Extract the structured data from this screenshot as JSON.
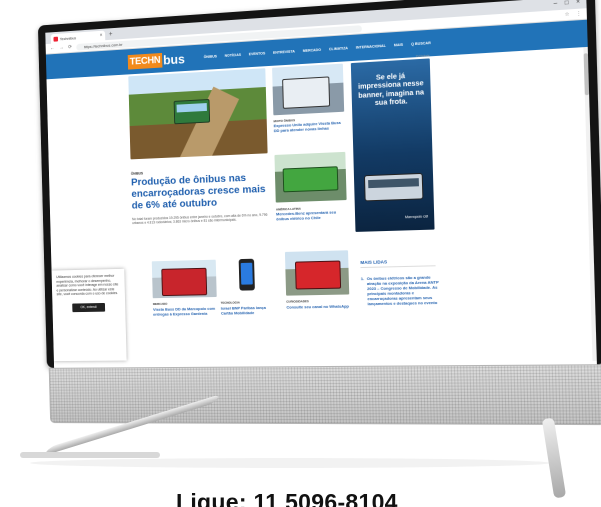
{
  "browser": {
    "tab_title": "Technibus",
    "tab_close": "×",
    "tab_new": "+",
    "url": "https://technibus.com.br",
    "window_controls": [
      "–",
      "□",
      "×"
    ],
    "nav_icons": [
      "←",
      "→",
      "⟳"
    ],
    "toolbar_icons": [
      "☆",
      "⋮"
    ]
  },
  "site": {
    "logo_tech": "TECHN",
    "logo_bus": "bus",
    "nav": [
      "ÔNIBUS",
      "NOTÍCIAS",
      "EVENTOS",
      "ENTREVISTA",
      "MERCADO",
      "CLIMATIZA",
      "INTERNACIONAL",
      "MAIS",
      "Q BUSCAR"
    ],
    "colors": {
      "header": "#2173b8",
      "logo_accent": "#f28a1c",
      "headline": "#1f5fae"
    }
  },
  "hero": {
    "tag": "ÔNIBUS",
    "title": "Produção de ônibus nas encarroçadoras cresce mais de 6% até outubro",
    "excerpt": "No total foram produzidos 19.295 ônibus entre janeiro e outubro, com alta de 6% no ano, 9.796 urbanos e 4.813 rodoviários; 3.863 micro ônibus e 81 são intermunicipais."
  },
  "articles": [
    {
      "tag": "MUITO ÔNIBUS",
      "title": "Expresso Unilo adquire Vissta Buss DD para atender novas linhas"
    },
    {
      "tag": "AMÉRICA LATINA",
      "title": "Mercedes-Benz apresentará seu ônibus elétrico no Chile"
    }
  ],
  "ad": {
    "label": "Publicidade",
    "text": "Se ele já impressiona nesse banner, imagina na sua frota.",
    "brand": "Marcopolo G8"
  },
  "lower_articles": [
    {
      "tag": "MERCADO",
      "title": "Vissta Buss DD da Marcopolo com entregas à Expresso Gardenia"
    },
    {
      "tag": "TECNOLOGIA",
      "title": "Israel BNP Paribas lança Cartão Mobilidade"
    },
    {
      "tag": "CURIOSIDADES",
      "title": "Consulte seu canal no WhatsApp"
    }
  ],
  "mais_lidas": {
    "heading": "MAIS LIDAS",
    "number": "1.",
    "item": "Os ônibus elétricos são a grande atração na exposição da Arena ANTP 2023 – Congresso de Mobilidade. As principais montadoras e encarroçadoras apresentam seus lançamentos e destaques no evento"
  },
  "cookie": {
    "text": "Utilizamos cookies para oferecer melhor experiência, melhorar o desempenho, analisar como você interage em nosso site e personalizar conteúdo. Ao utilizar este site, você concorda com o uso de cookies.",
    "button": "OK, entendi"
  },
  "footer": {
    "phone_line": "Ligue: 11 5096-8104"
  }
}
